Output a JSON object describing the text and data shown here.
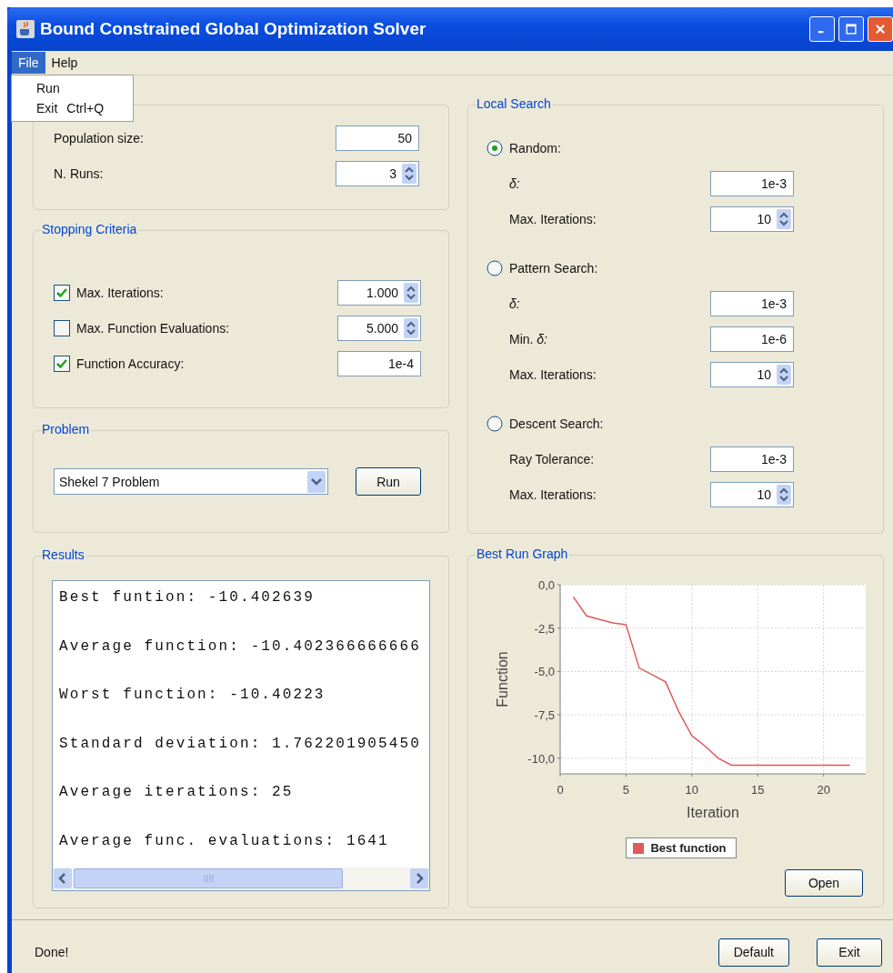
{
  "window": {
    "title": "Bound Constrained Global Optimization Solver"
  },
  "menu_bar": [
    {
      "label": "File",
      "selected": true
    },
    {
      "label": "Help",
      "selected": false
    }
  ],
  "open_menu": [
    {
      "label": "Run"
    },
    {
      "label": "Exit",
      "shortcut": "Ctrl+Q"
    }
  ],
  "population": {
    "fields": [
      {
        "label": "Population size:",
        "value": "50",
        "kind": "text"
      },
      {
        "label": "N. Runs:",
        "value": "3",
        "kind": "spinner"
      }
    ]
  },
  "stopping_criteria": {
    "title": "Stopping Criteria",
    "rows": [
      {
        "label": "Max. Iterations:",
        "checked": true,
        "value": "1.000",
        "kind": "spinner"
      },
      {
        "label": "Max. Function Evaluations:",
        "checked": false,
        "value": "5.000",
        "kind": "spinner"
      },
      {
        "label": "Function Accuracy:",
        "checked": true,
        "value": "1e-4",
        "kind": "text"
      }
    ]
  },
  "problem": {
    "title": "Problem",
    "selection": "Shekel 7 Problem",
    "button": "Run"
  },
  "results": {
    "title": "Results",
    "lines": [
      "Best funtion: -10.402639",
      "Average function: -10.402366666666",
      "Worst function: -10.40223",
      "Standard deviation: 1.762201905450",
      "Average iterations: 25",
      "Average func. evaluations: 1641"
    ]
  },
  "local_search": {
    "title": "Local Search",
    "methods": [
      {
        "label": "Random:",
        "selected": true,
        "fields": [
          {
            "label": "*δ:*",
            "value": "1e-3",
            "kind": "text"
          },
          {
            "label": "Max. Iterations:",
            "value": "10",
            "kind": "spinner"
          }
        ]
      },
      {
        "label": "Pattern Search:",
        "selected": false,
        "fields": [
          {
            "label": "*δ:*",
            "value": "1e-3",
            "kind": "text"
          },
          {
            "label": "Min.  *δ:*",
            "value": "1e-6",
            "kind": "text"
          },
          {
            "label": "Max. Iterations:",
            "value": "10",
            "kind": "spinner"
          }
        ]
      },
      {
        "label": "Descent Search:",
        "selected": false,
        "fields": [
          {
            "label": "Ray Tolerance:",
            "value": "1e-3",
            "kind": "text"
          },
          {
            "label": "Max. Iterations:",
            "value": "10",
            "kind": "spinner"
          }
        ]
      }
    ]
  },
  "best_run_graph": {
    "title": "Best Run Graph",
    "button": "Open",
    "chart_data": {
      "type": "line",
      "xlabel": "Iteration",
      "ylabel": "Function",
      "x": [
        1,
        2,
        3,
        4,
        5,
        6,
        7,
        8,
        9,
        10,
        11,
        12,
        13,
        14,
        15,
        16,
        17,
        18,
        19,
        20,
        21,
        22
      ],
      "series": [
        {
          "name": "Best function",
          "color": "#e05a5a",
          "values": [
            -0.7,
            -1.8,
            -2.0,
            -2.2,
            -2.3,
            -4.8,
            -5.2,
            -5.6,
            -7.3,
            -8.7,
            -9.3,
            -10.0,
            -10.4,
            -10.4,
            -10.4,
            -10.4,
            -10.4,
            -10.4,
            -10.4,
            -10.4,
            -10.4,
            -10.4
          ]
        }
      ],
      "grid": true,
      "xlim": [
        0,
        23.2
      ],
      "ylim": [
        -10.9,
        0
      ],
      "xticks": [
        0,
        5,
        10,
        15,
        20
      ],
      "yticks": [
        {
          "value": 0,
          "label": "0,0"
        },
        {
          "value": -2.5,
          "label": "-2,5"
        },
        {
          "value": -5,
          "label": "-5,0"
        },
        {
          "value": -7.5,
          "label": "-7,5"
        },
        {
          "value": -10,
          "label": "-10,0"
        }
      ]
    }
  },
  "status_bar": {
    "message": "Done!",
    "buttons": [
      "Default",
      "Exit"
    ]
  }
}
